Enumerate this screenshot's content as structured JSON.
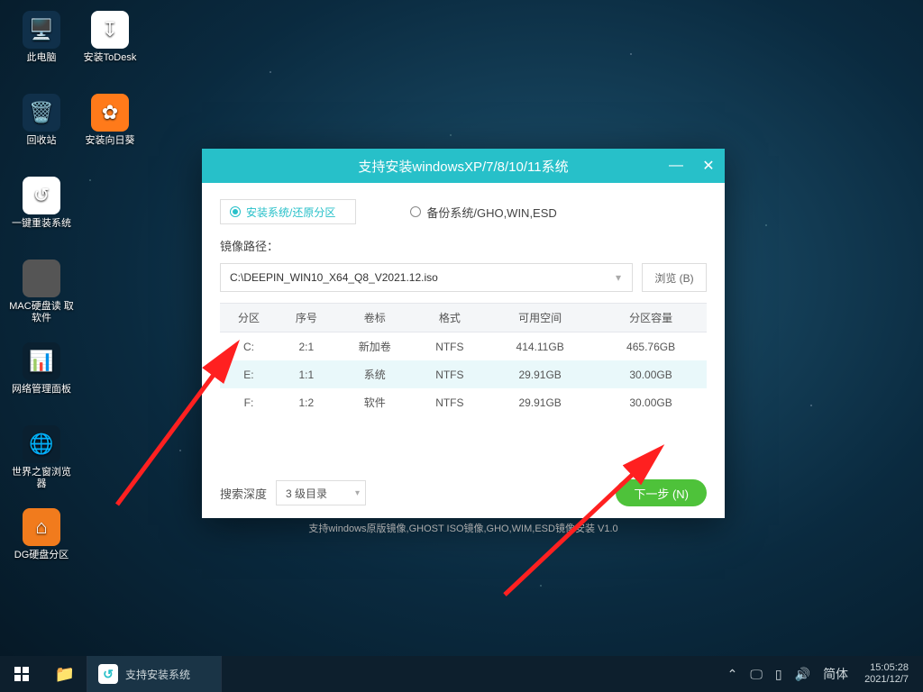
{
  "desktop": {
    "icons": [
      {
        "name": "this-pc",
        "label": "此电脑",
        "bg": "#10304a",
        "glyph": "🖥️"
      },
      {
        "name": "install-todesk",
        "label": "安装ToDesk",
        "bg": "#ffffff",
        "glyph": "↧"
      },
      {
        "name": "recycle-bin",
        "label": "回收站",
        "bg": "#10304a",
        "glyph": "🗑️"
      },
      {
        "name": "install-sunflower",
        "label": "安装向日葵",
        "bg": "#ff7a1a",
        "glyph": "✿"
      },
      {
        "name": "one-key-reinstall",
        "label": "一键重装系统",
        "bg": "#ffffff",
        "glyph": "↺"
      },
      {
        "name": "mac-hdd-reader",
        "label": "MAC硬盘读\n取软件",
        "bg": "#555",
        "glyph": ""
      },
      {
        "name": "network-panel",
        "label": "网络管理面板",
        "bg": "#0a2030",
        "glyph": "📊"
      },
      {
        "name": "world-browser",
        "label": "世界之窗浏览\n器",
        "bg": "#0a2030",
        "glyph": "🌐"
      },
      {
        "name": "dg-partition",
        "label": "DG硬盘分区",
        "bg": "#f17b1d",
        "glyph": "⌂"
      }
    ]
  },
  "window": {
    "title": "支持安装windowsXP/7/8/10/11系统",
    "mode_install": "安装系统/还原分区",
    "mode_backup": "备份系统/GHO,WIN,ESD",
    "path_label": "镜像路径：",
    "path_value": "C:\\DEEPIN_WIN10_X64_Q8_V2021.12.iso",
    "browse": "浏览 (B)",
    "table": {
      "headers": [
        "分区",
        "序号",
        "卷标",
        "格式",
        "可用空间",
        "分区容量"
      ],
      "rows": [
        [
          "C:",
          "2:1",
          "新加卷",
          "NTFS",
          "414.11GB",
          "465.76GB"
        ],
        [
          "E:",
          "1:1",
          "系统",
          "NTFS",
          "29.91GB",
          "30.00GB"
        ],
        [
          "F:",
          "1:2",
          "软件",
          "NTFS",
          "29.91GB",
          "30.00GB"
        ]
      ],
      "selected_index": 1
    },
    "depth_label": "搜索深度",
    "depth_value": "3 级目录",
    "next": "下一步 (N)",
    "supports": "支持windows原版镜像,GHOST ISO镜像,GHO,WIM,ESD镜像安装   V1.0"
  },
  "taskbar": {
    "task_label": "支持安装系统",
    "ime": "简体",
    "time": "15:05:28",
    "date": "2021/12/7"
  }
}
